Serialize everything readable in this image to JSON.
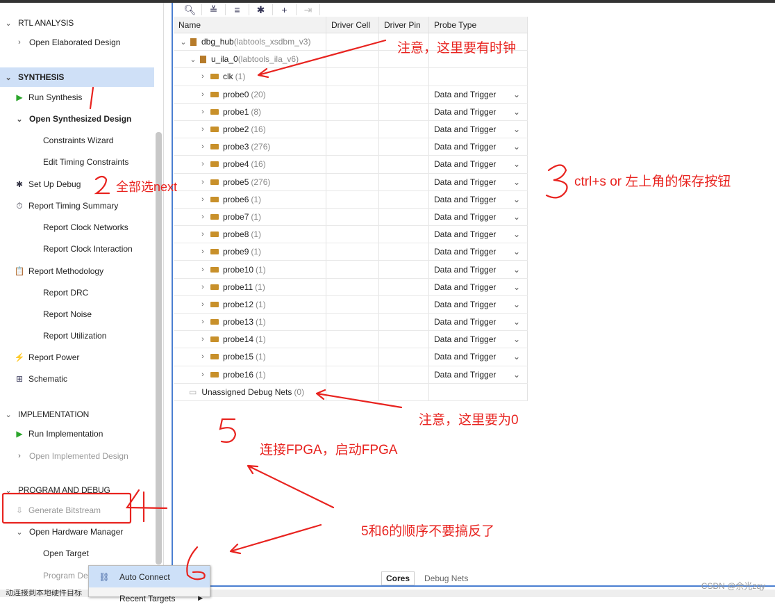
{
  "flow_navigator": {
    "items": [
      {
        "label": "RTL ANALYSIS",
        "type": "section",
        "chevron": "down"
      },
      {
        "label": "Open Elaborated Design",
        "type": "item",
        "chevron": "right"
      },
      {
        "label": "SYNTHESIS",
        "type": "section",
        "chevron": "down",
        "selected": true
      },
      {
        "label": "Run Synthesis",
        "icon": "play-icon"
      },
      {
        "label": "Open Synthesized Design",
        "chevron": "down",
        "bold": true
      },
      {
        "label": "Constraints Wizard",
        "indent": 2
      },
      {
        "label": "Edit Timing Constraints",
        "indent": 2
      },
      {
        "label": "Set Up Debug",
        "icon": "bug-icon"
      },
      {
        "label": "Report Timing Summary",
        "icon": "clock-icon"
      },
      {
        "label": "Report Clock Networks",
        "indent": 2
      },
      {
        "label": "Report Clock Interaction",
        "indent": 2
      },
      {
        "label": "Report Methodology",
        "icon": "clipboard-icon"
      },
      {
        "label": "Report DRC",
        "indent": 2
      },
      {
        "label": "Report Noise",
        "indent": 2
      },
      {
        "label": "Report Utilization",
        "indent": 2
      },
      {
        "label": "Report Power",
        "icon": "power-icon"
      },
      {
        "label": "Schematic",
        "icon": "schematic-icon"
      },
      {
        "label": "IMPLEMENTATION",
        "type": "section",
        "chevron": "down"
      },
      {
        "label": "Run Implementation",
        "icon": "play-icon"
      },
      {
        "label": "Open Implemented Design",
        "chevron": "right",
        "disabled": true
      },
      {
        "label": "PROGRAM AND DEBUG",
        "type": "section",
        "chevron": "down"
      },
      {
        "label": "Generate Bitstream",
        "icon": "bitstream-icon",
        "disabled": true
      },
      {
        "label": "Open Hardware Manager",
        "chevron": "down"
      },
      {
        "label": "Open Target",
        "indent": 2
      },
      {
        "label": "Program De",
        "indent": 2,
        "disabled": true
      }
    ]
  },
  "toolbar": {
    "icons": [
      "search-icon",
      "collapse-all-icon",
      "expand-all-icon",
      "bug-icon",
      "add-icon",
      "disconnect-icon"
    ]
  },
  "table": {
    "headers": [
      "Name",
      "Driver Cell",
      "Driver Pin",
      "Probe Type"
    ],
    "hub": {
      "name": "dbg_hub",
      "type": "(labtools_xsdbm_v3)"
    },
    "ila": {
      "name": "u_ila_0",
      "type": "(labtools_ila_v6)"
    },
    "nets": [
      {
        "name": "clk",
        "count": "(1)",
        "probe_type": ""
      },
      {
        "name": "probe0",
        "count": "(20)",
        "probe_type": "Data and Trigger"
      },
      {
        "name": "probe1",
        "count": "(8)",
        "probe_type": "Data and Trigger"
      },
      {
        "name": "probe2",
        "count": "(16)",
        "probe_type": "Data and Trigger"
      },
      {
        "name": "probe3",
        "count": "(276)",
        "probe_type": "Data and Trigger"
      },
      {
        "name": "probe4",
        "count": "(16)",
        "probe_type": "Data and Trigger"
      },
      {
        "name": "probe5",
        "count": "(276)",
        "probe_type": "Data and Trigger"
      },
      {
        "name": "probe6",
        "count": "(1)",
        "probe_type": "Data and Trigger"
      },
      {
        "name": "probe7",
        "count": "(1)",
        "probe_type": "Data and Trigger"
      },
      {
        "name": "probe8",
        "count": "(1)",
        "probe_type": "Data and Trigger"
      },
      {
        "name": "probe9",
        "count": "(1)",
        "probe_type": "Data and Trigger"
      },
      {
        "name": "probe10",
        "count": "(1)",
        "probe_type": "Data and Trigger"
      },
      {
        "name": "probe11",
        "count": "(1)",
        "probe_type": "Data and Trigger"
      },
      {
        "name": "probe12",
        "count": "(1)",
        "probe_type": "Data and Trigger"
      },
      {
        "name": "probe13",
        "count": "(1)",
        "probe_type": "Data and Trigger"
      },
      {
        "name": "probe14",
        "count": "(1)",
        "probe_type": "Data and Trigger"
      },
      {
        "name": "probe15",
        "count": "(1)",
        "probe_type": "Data and Trigger"
      },
      {
        "name": "probe16",
        "count": "(1)",
        "probe_type": "Data and Trigger"
      }
    ],
    "unassigned": {
      "name": "Unassigned Debug Nets",
      "count": "(0)"
    }
  },
  "bottom_tabs": [
    "Cores",
    "Debug Nets"
  ],
  "context_menu": {
    "items": [
      "Auto Connect",
      "Recent Targets"
    ]
  },
  "status_bar": "动连接到本地硬件目标",
  "annotations": {
    "clock_note": "注意，这里要有时钟",
    "step2": "全部选next",
    "step3": "ctrl+s  or 左上角的保存按钮",
    "zero_note": "注意，这里要为0",
    "step5": "连接FPGA，启动FPGA",
    "order_note": "5和6的顺序不要搞反了",
    "color": "#e8231f"
  },
  "watermark": "CSDN @余光zqy"
}
